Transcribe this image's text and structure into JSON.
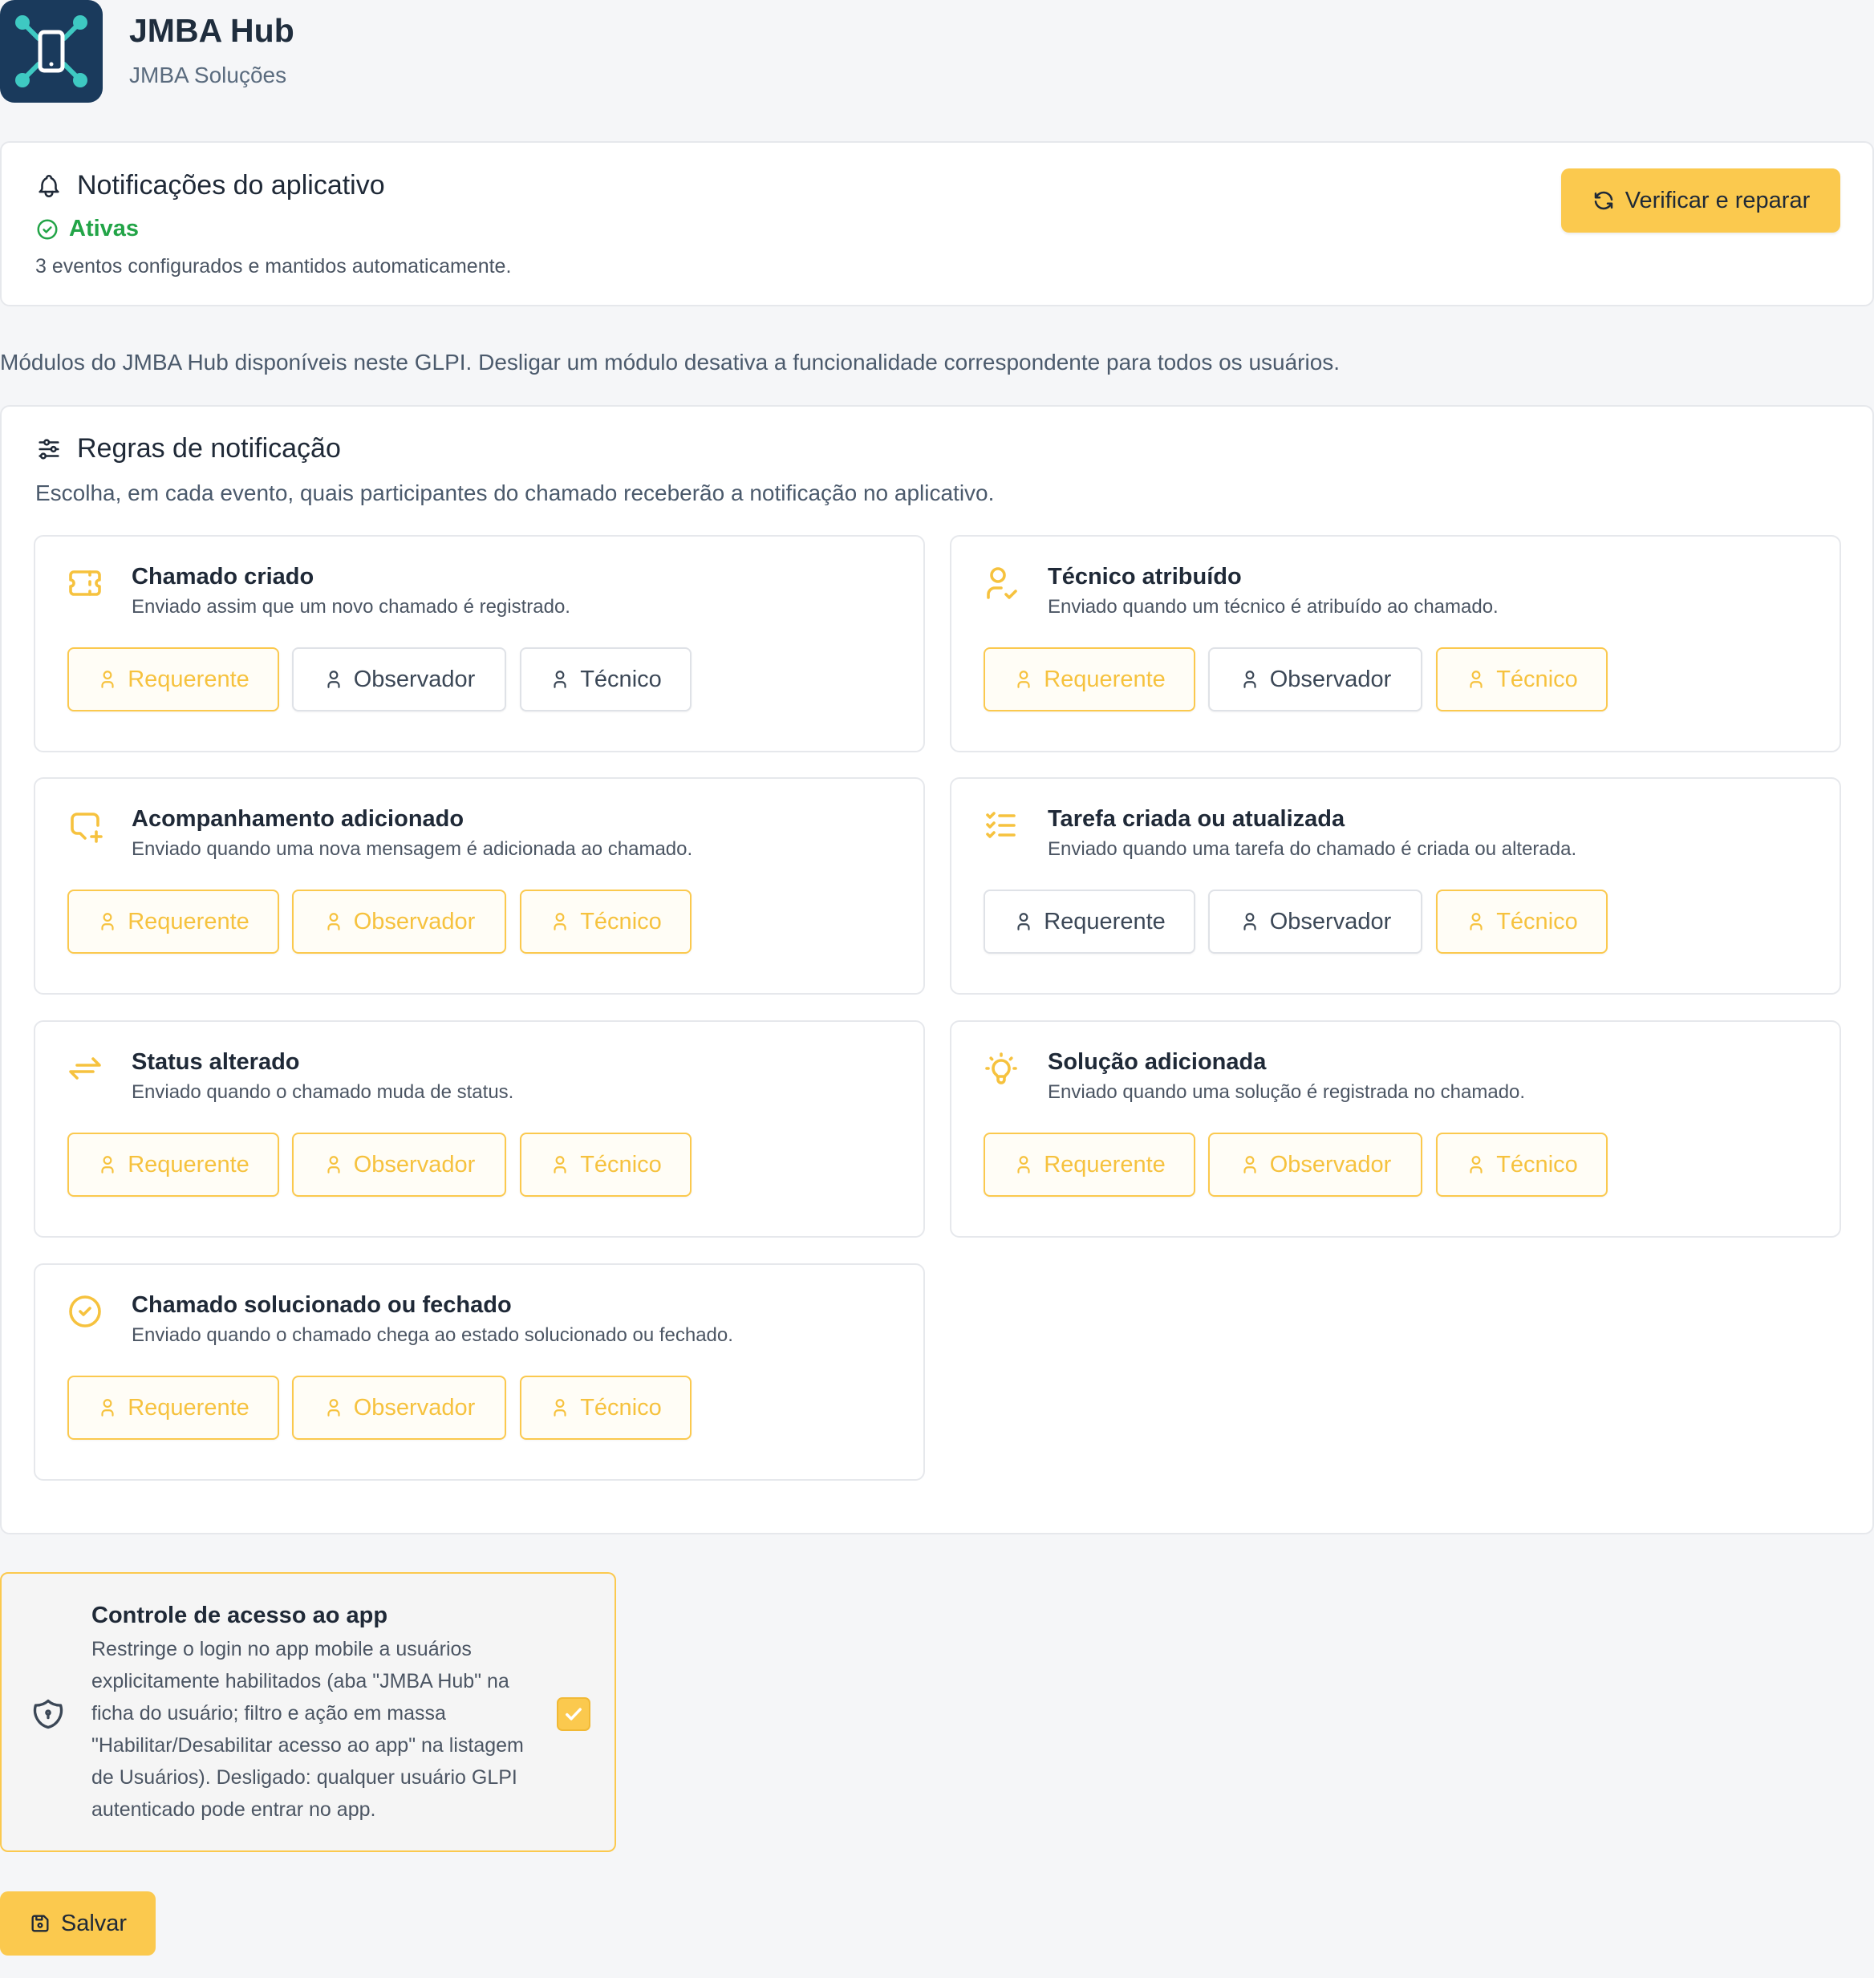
{
  "app": {
    "name": "JMBA Hub",
    "company": "JMBA Soluções",
    "logo_icon": "device-network-icon"
  },
  "notifications": {
    "title": "Notificações do aplicativo",
    "state": "Ativas",
    "description": "3 eventos configurados e mantidos automaticamente.",
    "repair_label": "Verificar e reparar"
  },
  "modules_intro": "Módulos do JMBA Hub disponíveis neste GLPI. Desligar um módulo desativa a funcionalidade correspondente para todos os usuários.",
  "rules": {
    "title": "Regras de notificação",
    "description": "Escolha, em cada evento, quais participantes do chamado receberão a notificação no aplicativo.",
    "roles": [
      "Requerente",
      "Observador",
      "Técnico"
    ],
    "events": [
      {
        "title": "Chamado criado",
        "description": "Enviado assim que um novo chamado é registrado.",
        "icon": "ticket-icon",
        "enabled": [
          true,
          false,
          false
        ]
      },
      {
        "title": "Técnico atribuído",
        "description": "Enviado quando um técnico é atribuído ao chamado.",
        "icon": "user-check-icon",
        "enabled": [
          true,
          false,
          true
        ]
      },
      {
        "title": "Acompanhamento adicionado",
        "description": "Enviado quando uma nova mensagem é adicionada ao chamado.",
        "icon": "message-plus-icon",
        "enabled": [
          true,
          true,
          true
        ]
      },
      {
        "title": "Tarefa criada ou atualizada",
        "description": "Enviado quando uma tarefa do chamado é criada ou alterada.",
        "icon": "list-check-icon",
        "enabled": [
          false,
          false,
          true
        ]
      },
      {
        "title": "Status alterado",
        "description": "Enviado quando o chamado muda de status.",
        "icon": "arrows-exchange-icon",
        "enabled": [
          true,
          true,
          true
        ]
      },
      {
        "title": "Solução adicionada",
        "description": "Enviado quando uma solução é registrada no chamado.",
        "icon": "bulb-icon",
        "enabled": [
          true,
          true,
          true
        ]
      },
      {
        "title": "Chamado solucionado ou fechado",
        "description": "Enviado quando o chamado chega ao estado solucionado ou fechado.",
        "icon": "circle-check-icon",
        "enabled": [
          true,
          true,
          true
        ]
      }
    ]
  },
  "access_control": {
    "title": "Controle de acesso ao app",
    "description": "Restringe o login no app mobile a usuários explicitamente habilitados (aba \"JMBA Hub\" na ficha do usuário; filtro e ação em massa \"Habilitar/Desabilitar acesso ao app\" na listagem de Usuários). Desligado: qualquer usuário GLPI autenticado pode entrar no app.",
    "checked": true
  },
  "save_label": "Salvar",
  "colors": {
    "accent": "#fbc94e",
    "success": "#22a447",
    "logo_bg": "#1a3a5c",
    "logo_fg": "#3ec9c2"
  }
}
